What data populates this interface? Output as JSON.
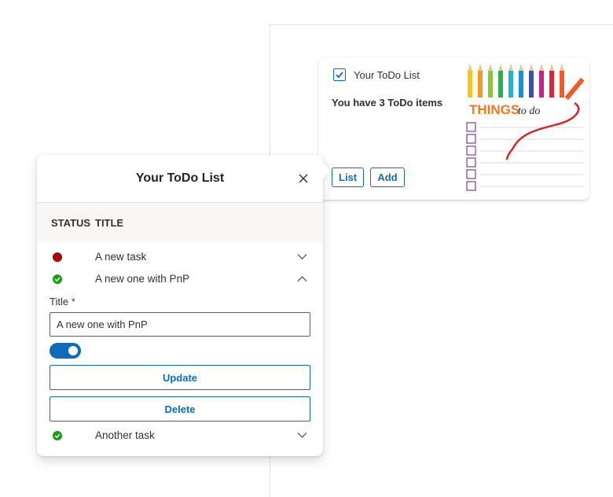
{
  "card": {
    "title": "Your ToDo List",
    "count_text": "You have 3 ToDo items",
    "list_label": "List",
    "add_label": "Add",
    "image_text_1": "THINGS",
    "image_text_2": "to do"
  },
  "panel": {
    "title": "Your ToDo List",
    "columns": {
      "status": "STATUS",
      "title": "TITLE"
    },
    "items": [
      {
        "title": "A new task",
        "status": "incomplete",
        "status_color": "#a80000",
        "expanded": false
      },
      {
        "title": "A new one with PnP",
        "status": "complete",
        "status_color": "#13a10e",
        "expanded": true
      },
      {
        "title": "Another task",
        "status": "complete",
        "status_color": "#13a10e",
        "expanded": false
      }
    ],
    "form": {
      "title_label": "Title",
      "required_mark": "*",
      "title_value": "A new one with PnP",
      "toggle_on": true,
      "update_label": "Update",
      "delete_label": "Delete"
    }
  },
  "colors": {
    "accent": "#0f6cbd",
    "complete": "#13a10e",
    "incomplete": "#a80000"
  }
}
